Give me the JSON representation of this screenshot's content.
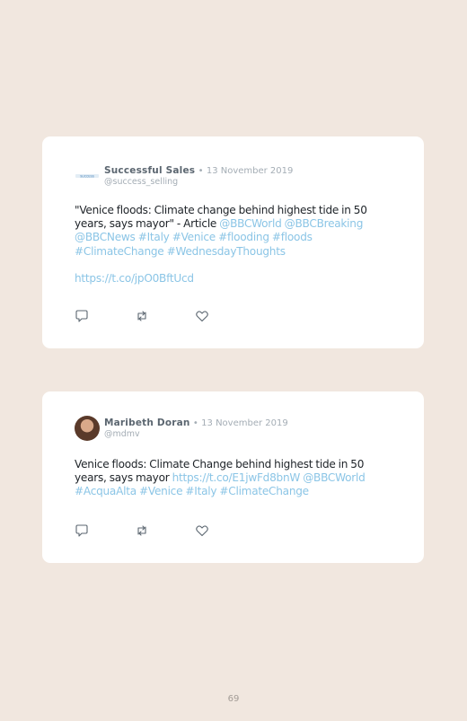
{
  "tweets": [
    {
      "author_name": "Successful Sales",
      "separator": "•",
      "date": "13 November 2019",
      "handle": "@success_selling",
      "avatar_logo_text": "SUCCESS",
      "text_line1": "\"Venice floods: Climate change behind highest tide in 50 years, says mayor\" - Article ",
      "mention1": "@BBCWorld",
      "mention2": "@BBCBreaking",
      "mention3": "@BBCNews",
      "tag1": "#Italy",
      "tag2": "#Venice",
      "tag3": "#flooding",
      "tag4": "#floods",
      "tag5": "#ClimateChange",
      "tag6": "#WednesdayThoughts",
      "url": "https://t.co/jpO0BftUcd"
    },
    {
      "author_name": "Maribeth Doran",
      "separator": "•",
      "date": "13 November 2019",
      "handle": "@mdmv",
      "text_line1": "Venice floods: Climate Change behind highest tide in 50 years, says mayor ",
      "url": "https://t.co/E1jwFd8bnW",
      "mention1": "@BBCWorld",
      "tag1": "#AcquaAlta",
      "tag2": "#Venice",
      "tag3": "#Italy",
      "tag4": "#ClimateChange"
    }
  ],
  "page_number": "69",
  "colors": {
    "background": "#f1e7df",
    "card": "#ffffff",
    "link": "#8bc5e6",
    "muted": "#a4adb5"
  },
  "icons": [
    "reply-icon",
    "retweet-icon",
    "like-icon"
  ]
}
